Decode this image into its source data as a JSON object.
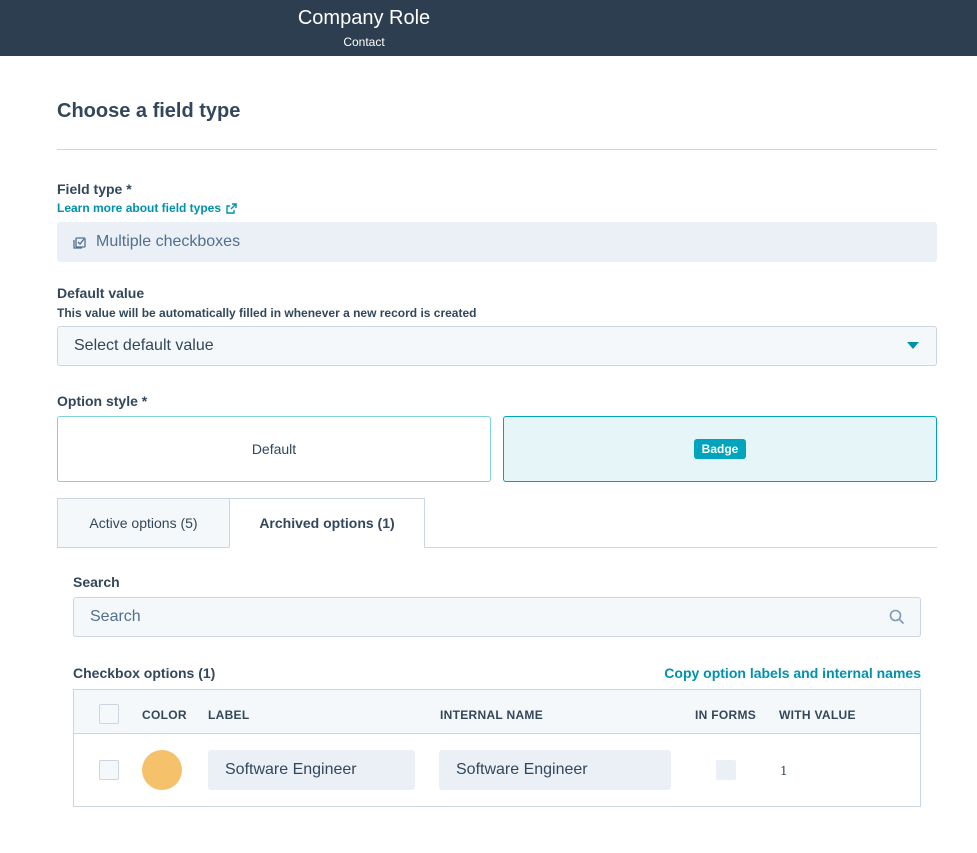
{
  "header": {
    "title": "Company Role",
    "subtitle": "Contact"
  },
  "page": {
    "title": "Choose a field type"
  },
  "field_type": {
    "label": "Field type *",
    "learn_more": "Learn more about field types",
    "value": "Multiple checkboxes",
    "icon": "checkbox-icon"
  },
  "default_value": {
    "label": "Default value",
    "help": "This value will be automatically filled in whenever a new record is created",
    "placeholder": "Select default value"
  },
  "option_style": {
    "label": "Option style *",
    "default_label": "Default",
    "badge_label": "Badge",
    "selected": "Badge"
  },
  "tabs": {
    "active": "Active options (5)",
    "archived": "Archived options (1)",
    "selected": "archived"
  },
  "search": {
    "label": "Search",
    "placeholder": "Search"
  },
  "options": {
    "title": "Checkbox options (1)",
    "copy_link": "Copy option labels and internal names",
    "columns": {
      "color": "COLOR",
      "label": "LABEL",
      "internal_name": "INTERNAL NAME",
      "in_forms": "IN FORMS",
      "with_value": "WITH VALUE"
    },
    "rows": [
      {
        "color": "#f5c26b",
        "label": "Software Engineer",
        "internal_name": "Software Engineer",
        "in_forms": false,
        "with_value": "1"
      }
    ]
  },
  "colors": {
    "header_bg": "#2d3e50",
    "accent": "#0091ae",
    "badge": "#00a4bd",
    "text": "#33475b"
  }
}
